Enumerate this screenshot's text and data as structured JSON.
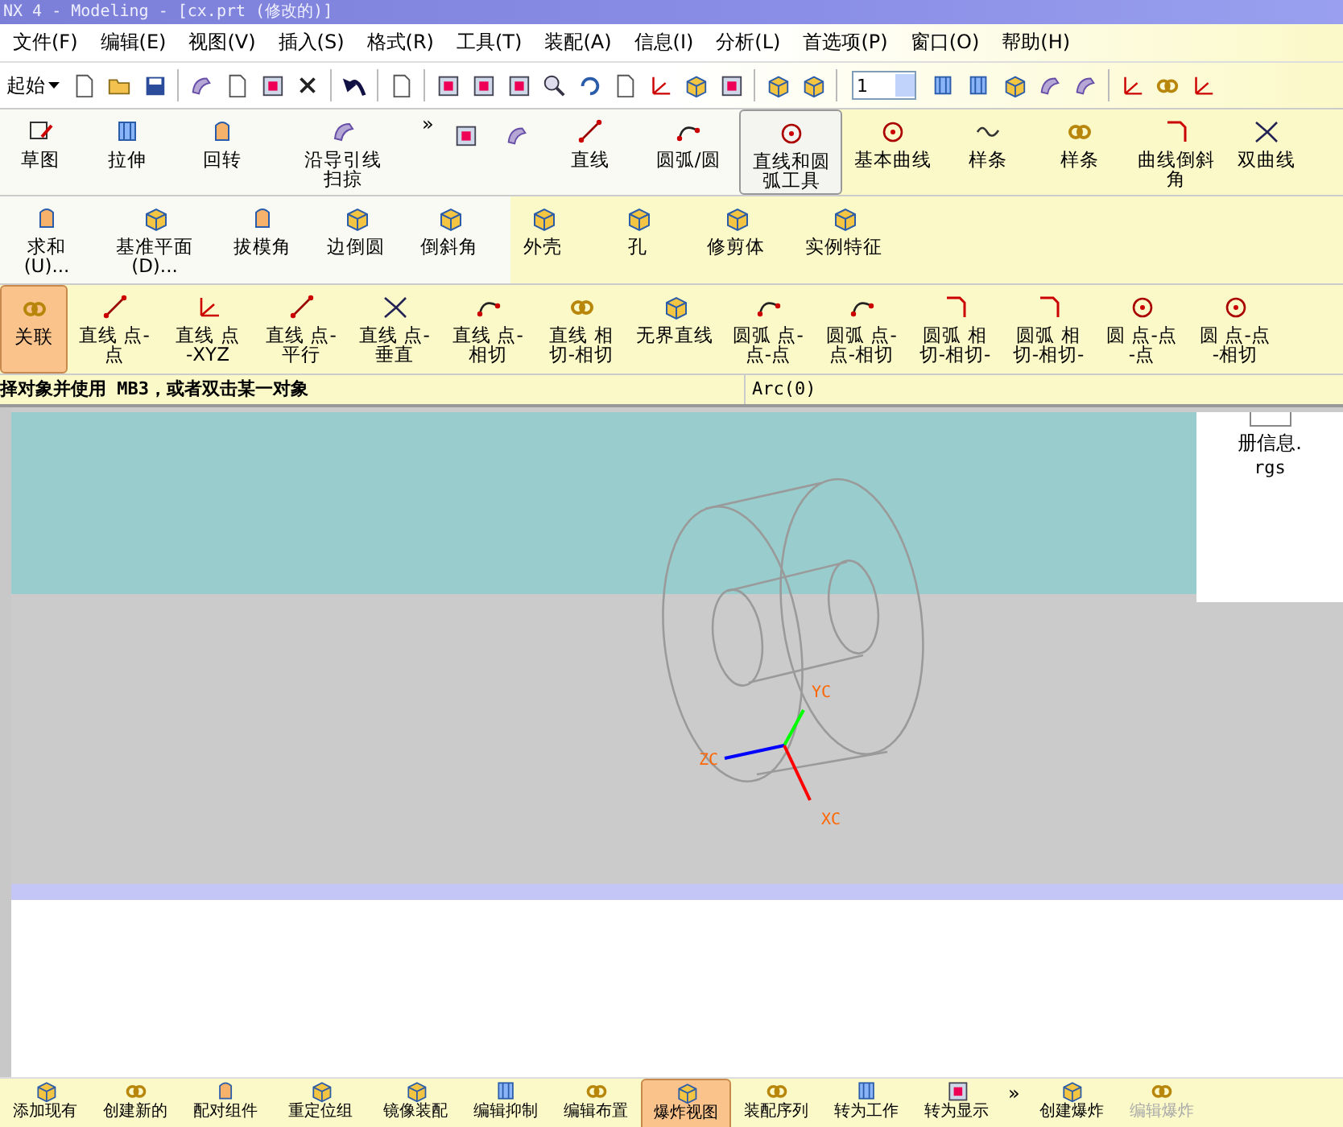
{
  "window": {
    "title": "NX 4 - Modeling - [cx.prt (修改的)]"
  },
  "menu": [
    "文件(F)",
    "编辑(E)",
    "视图(V)",
    "插入(S)",
    "格式(R)",
    "工具(T)",
    "装配(A)",
    "信息(I)",
    "分析(L)",
    "首选项(P)",
    "窗口(O)",
    "帮助(H)"
  ],
  "standard_toolbar": {
    "start": "起始",
    "layer": "1"
  },
  "feature_row": [
    {
      "label": "草图",
      "hover": false
    },
    {
      "label": "拉伸",
      "hover": false
    },
    {
      "label": "回转",
      "hover": false
    },
    {
      "label": "沿导引线扫掠",
      "hover": false
    },
    {
      "label": "直线",
      "hover": false
    },
    {
      "label": "圆弧/圆",
      "hover": false
    },
    {
      "label": "直线和圆弧工具",
      "hover": true
    },
    {
      "label": "基本曲线",
      "hover": false
    },
    {
      "label": "样条",
      "hover": false
    },
    {
      "label": "样条",
      "hover": false
    },
    {
      "label": "曲线倒斜角",
      "hover": false
    },
    {
      "label": "双曲线",
      "hover": false
    }
  ],
  "overflow": "»",
  "form_row": [
    {
      "label": "求和\n(U)..."
    },
    {
      "label": "基准平面\n(D)..."
    },
    {
      "label": "拔模角"
    },
    {
      "label": "边倒圆"
    },
    {
      "label": "倒斜角"
    },
    {
      "label": "外壳"
    },
    {
      "label": "孔"
    },
    {
      "label": "修剪体"
    },
    {
      "label": "实例特征"
    }
  ],
  "curve_row": [
    {
      "label": "关联",
      "selected": true
    },
    {
      "label": "直线 点-\n点",
      "selected": false
    },
    {
      "label": "直线 点\n-XYZ",
      "selected": false
    },
    {
      "label": "直线 点-\n平行",
      "selected": false
    },
    {
      "label": "直线 点-\n垂直",
      "selected": false
    },
    {
      "label": "直线 点-\n相切",
      "selected": false
    },
    {
      "label": "直线 相切-相切",
      "selected": false
    },
    {
      "label": "无界直线",
      "selected": false
    },
    {
      "label": "圆弧 点-\n点-点",
      "selected": false
    },
    {
      "label": "圆弧 点-\n点-相切",
      "selected": false
    },
    {
      "label": "圆弧 相切-相切-",
      "selected": false
    },
    {
      "label": "圆弧 相切-相切-",
      "selected": false
    },
    {
      "label": "圆 点-点\n-点",
      "selected": false
    },
    {
      "label": "圆 点-点\n-相切",
      "selected": false
    }
  ],
  "status": {
    "prompt": "择对象并使用 MB3，或者双击某一对象",
    "message": "Arc(0)"
  },
  "viewport": {
    "axes": [
      "YC",
      "ZC",
      "XC"
    ],
    "panel": {
      "title": "册信息.",
      "subtitle": "rgs"
    }
  },
  "assembly_row": [
    {
      "label": "添加现有",
      "selected": false
    },
    {
      "label": "创建新的",
      "selected": false
    },
    {
      "label": "配对组件",
      "selected": false
    },
    {
      "label": "重定位组",
      "selected": false
    },
    {
      "label": "镜像装配",
      "selected": false
    },
    {
      "label": "编辑抑制",
      "selected": false
    },
    {
      "label": "编辑布置",
      "selected": false
    },
    {
      "label": "爆炸视图",
      "selected": true
    },
    {
      "label": "装配序列",
      "selected": false
    },
    {
      "label": "转为工作",
      "selected": false
    },
    {
      "label": "转为显示",
      "selected": false
    },
    {
      "label": "创建爆炸",
      "selected": false
    },
    {
      "label": "编辑爆炸",
      "selected": false
    }
  ],
  "assembly_overflow": "»"
}
